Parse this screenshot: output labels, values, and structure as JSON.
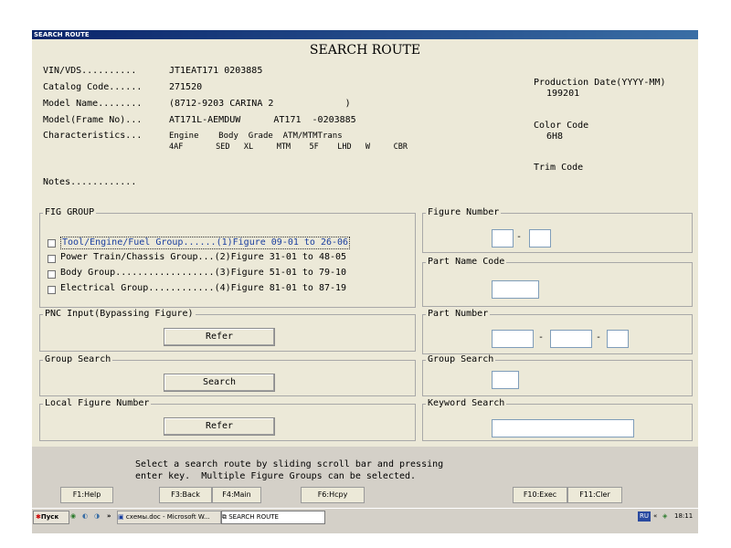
{
  "window": {
    "title": "SEARCH ROUTE",
    "heading": "SEARCH ROUTE"
  },
  "vehicle": {
    "vin_label": "VIN/VDS..........",
    "vin_value": "JT1EAT171 0203885",
    "catalog_label": "Catalog Code......",
    "catalog_value": "271520",
    "model_name_label": "Model Name........",
    "model_name_value": "(8712-9203 CARINA 2             )",
    "model_frame_label": "Model(Frame No)...",
    "model_frame_value": "AT171L-AEMDUW      AT171  -0203885",
    "char_label": "Characteristics...",
    "char_headers": "Engine    Body  Grade  ATM/MTMTrans",
    "char_values": "4AF       SED   XL     MTM    5F    LHD   W     CBR",
    "notes_label": "Notes............"
  },
  "right_info": {
    "prod_label": "Production Date(YYYY-MM)",
    "prod_value": "199201",
    "color_label": "Color Code",
    "color_value": "6H8",
    "trim_label": "Trim Code"
  },
  "fig_group": {
    "title": "FIG GROUP",
    "items": [
      "Tool/Engine/Fuel Group......(1)Figure 09-01 to 26-06",
      "Power Train/Chassis Group...(2)Figure 31-01 to 48-05",
      "Body Group..................(3)Figure 51-01 to 79-10",
      "Electrical Group............(4)Figure 81-01 to 87-19"
    ]
  },
  "pnc": {
    "title": "PNC Input(Bypassing Figure)",
    "button": "Refer"
  },
  "group_search_left": {
    "title": "Group Search",
    "button": "Search"
  },
  "local_fig": {
    "title": "Local Figure Number",
    "button": "Refer"
  },
  "figure_number": {
    "title": "Figure Number",
    "sep": "-"
  },
  "part_name_code": {
    "title": "Part Name Code"
  },
  "part_number": {
    "title": "Part Number",
    "sep1": "-",
    "sep2": "-"
  },
  "group_search_right": {
    "title": "Group Search"
  },
  "keyword_search": {
    "title": "Keyword Search"
  },
  "message": {
    "line1": "Select a search route by sliding scroll bar and pressing",
    "line2": "enter key.  Multiple Figure Groups can be selected."
  },
  "fkeys": [
    "F1:Help",
    "F3:Back",
    "F4:Main",
    "F6:Hcpy",
    "F10:Exec",
    "F11:Cler"
  ],
  "taskbar": {
    "start": "Пуск",
    "arrows": "»",
    "task1": "схемы.doc - Microsoft W...",
    "task2": "SEARCH ROUTE",
    "lang": "RU",
    "tray_arrows": "«",
    "clock": "18:11"
  }
}
